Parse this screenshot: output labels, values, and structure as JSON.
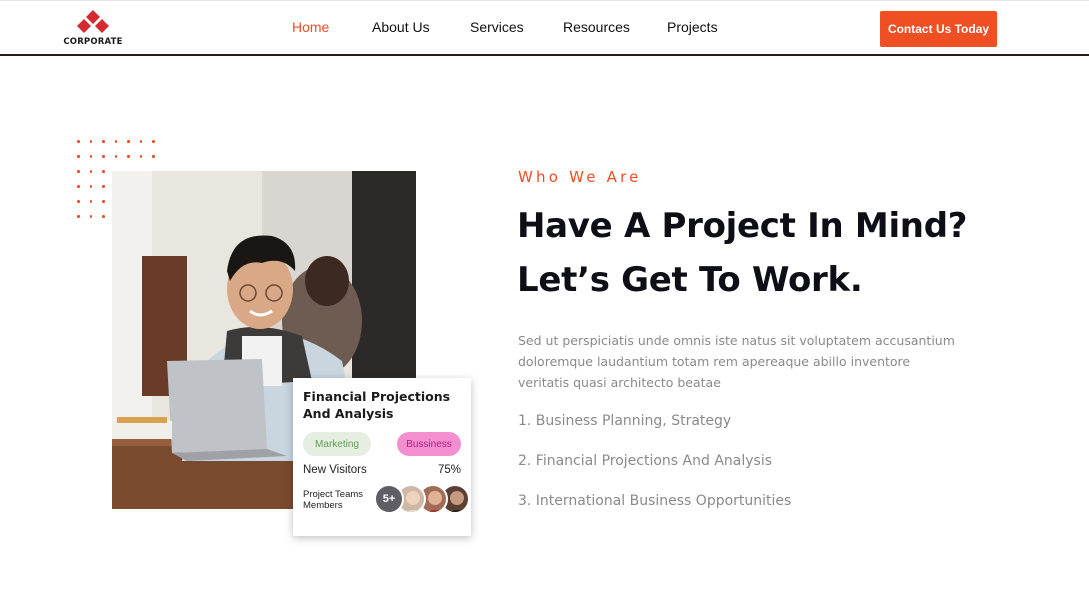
{
  "header": {
    "logo_text": "CORPORATE",
    "nav": [
      {
        "label": "Home",
        "active": true
      },
      {
        "label": "About Us",
        "active": false
      },
      {
        "label": "Services",
        "active": false
      },
      {
        "label": "Resources",
        "active": false
      },
      {
        "label": "Projects",
        "active": false
      }
    ],
    "cta_label": "Contact Us Today"
  },
  "card": {
    "title": "Financial Projections And Analysis",
    "tags": [
      "Marketing",
      "Bussiness"
    ],
    "stat_label": "New Visitors",
    "stat_value": "75%",
    "members_label": "Project Teams Members",
    "members_count": "5+"
  },
  "content": {
    "eyebrow": "Who We Are",
    "headline_line1": "Have A Project In Mind?",
    "headline_line2": "Let’s Get To Work.",
    "description": "Sed ut perspiciatis unde omnis iste natus sit voluptatem accusantium doloremque laudantium totam rem apereaque abillo inventore veritatis quasi architecto beatae",
    "list": [
      "1. Business Planning, Strategy",
      "2. Financial Projections And Analysis",
      "3. International Business Opportunities"
    ]
  },
  "colors": {
    "accent": "#f04e23",
    "heading": "#0e0e16",
    "muted": "#8a8a8a"
  },
  "icons": [
    "logo-diamond-icon",
    "decorative-dots"
  ]
}
